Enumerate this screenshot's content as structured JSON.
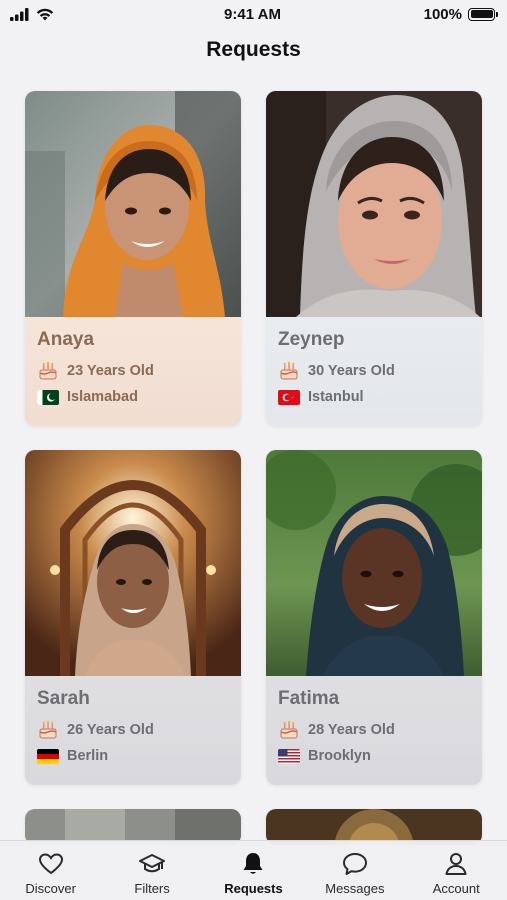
{
  "status_bar": {
    "time": "9:41 AM",
    "battery": "100%"
  },
  "page": {
    "title": "Requests"
  },
  "cards": [
    {
      "name": "Anaya",
      "age": "23 Years Old",
      "city": "Islamabad",
      "flag": "pakistan-flag"
    },
    {
      "name": "Zeynep",
      "age": "30 Years Old",
      "city": "Istanbul",
      "flag": "turkey-flag"
    },
    {
      "name": "Sarah",
      "age": "26 Years Old",
      "city": "Berlin",
      "flag": "germany-flag"
    },
    {
      "name": "Fatima",
      "age": "28 Years Old",
      "city": "Brooklyn",
      "flag": "usa-flag"
    }
  ],
  "tabbar": {
    "items": [
      {
        "label": "Discover",
        "icon": "heart-icon"
      },
      {
        "label": "Filters",
        "icon": "graduation-cap-icon"
      },
      {
        "label": "Requests",
        "icon": "bell-icon",
        "active": true
      },
      {
        "label": "Messages",
        "icon": "chat-bubble-icon"
      },
      {
        "label": "Account",
        "icon": "person-icon"
      }
    ]
  },
  "colors": {
    "background": "#f2f2f4",
    "warm_panel": "#f4e2d6",
    "text_muted": "#6d6d72"
  }
}
